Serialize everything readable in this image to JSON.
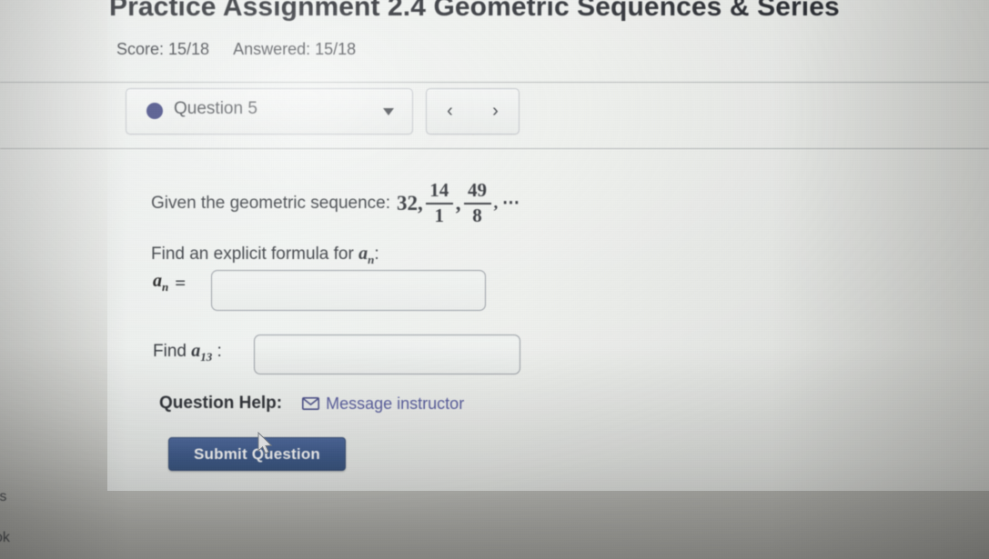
{
  "header": {
    "title": "Practice Assignment 2.4 Geometric Sequences & Series",
    "score_label": "Score: 15/18",
    "answered_label": "Answered: 15/18"
  },
  "question_bar": {
    "status_dot_color": "#242a6e",
    "question_label": "Question 5",
    "caret_icon": "chevron-down-icon",
    "prev_label": "‹",
    "next_label": "›"
  },
  "problem": {
    "given_prefix": "Given the geometric sequence:",
    "first_term": "32,",
    "fraction_1": {
      "numerator": "14",
      "denominator": "1"
    },
    "comma_1": ",",
    "fraction_2": {
      "numerator": "49",
      "denominator": "8"
    },
    "tail": ", ⋯"
  },
  "formula_section": {
    "prompt_prefix": "Find an explicit formula for",
    "prompt_symbol": "a",
    "prompt_subscript": "n",
    "prompt_suffix": ":",
    "label_symbol": "a",
    "label_subscript": "n",
    "equals": "=",
    "input_value": "",
    "input_placeholder": ""
  },
  "term_section": {
    "label_prefix": "Find",
    "label_symbol": "a",
    "label_subscript": "13",
    "label_suffix": ":",
    "input_value": "",
    "input_placeholder": ""
  },
  "help": {
    "label": "Question Help:",
    "envelope_icon": "envelope-icon",
    "message_link": "Message instructor",
    "link_color": "#4a4f96"
  },
  "actions": {
    "submit_label": "Submit Question",
    "submit_color": "#2f4e84"
  },
  "offscreen_clipped": {
    "line_1": "rs",
    "line_2": "ok"
  }
}
